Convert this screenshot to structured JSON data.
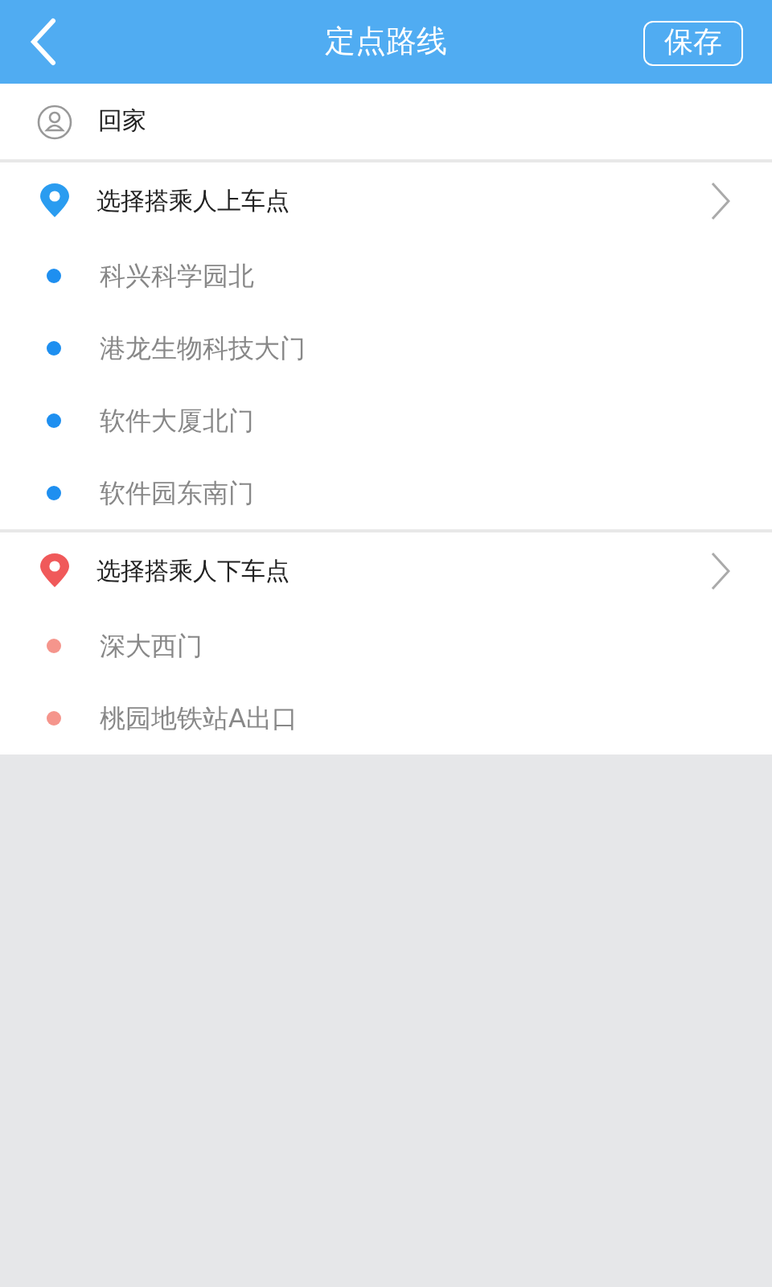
{
  "header": {
    "title": "定点路线",
    "save": "保存"
  },
  "route": {
    "name": "回家"
  },
  "sections": [
    {
      "label": "选择搭乘人上车点",
      "color": "#2a9cf0",
      "stops": [
        {
          "name": "科兴科学园北",
          "color": "#1e8ff0"
        },
        {
          "name": "港龙生物科技大门",
          "color": "#1e8ff0"
        },
        {
          "name": "软件大厦北门",
          "color": "#1e8ff0"
        },
        {
          "name": "软件园东南门",
          "color": "#1e8ff0"
        }
      ]
    },
    {
      "label": "选择搭乘人下车点",
      "color": "#f0595a",
      "stops": [
        {
          "name": "深大西门",
          "color": "#f5958c"
        },
        {
          "name": "桃园地铁站A出口",
          "color": "#f5958c"
        }
      ]
    }
  ]
}
